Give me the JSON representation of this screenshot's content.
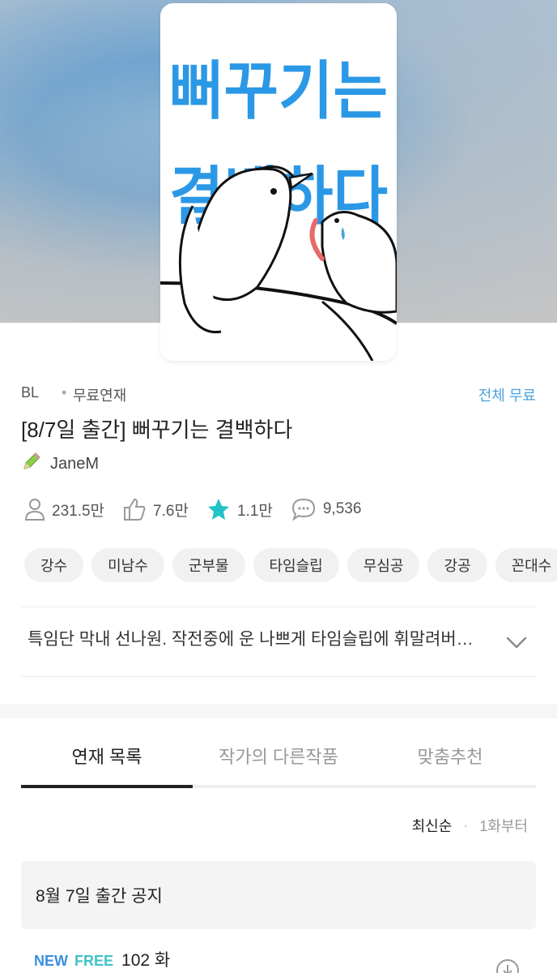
{
  "work": {
    "genre": "BL",
    "serial_type": "무료연재",
    "free_badge": "전체 무료",
    "title": "[8/7일 출간] 뻐꾸기는 결백하다",
    "author": "JaneM",
    "cover_title_line1": "뻐꾸기는",
    "cover_title_line2": "결백하다"
  },
  "stats": {
    "views": "231.5만",
    "likes": "7.6만",
    "favorites": "1.1만",
    "comments": "9,536"
  },
  "tags": [
    "강수",
    "미남수",
    "군부물",
    "타임슬립",
    "무심공",
    "강공",
    "꼰대수"
  ],
  "synopsis": "특임단 막내 선나원. 작전중에 운 나쁘게 타임슬립에 휘말려버…",
  "tabs": {
    "items": [
      "연재 목록",
      "작가의 다른작품",
      "맞춤추천"
    ],
    "active": 0
  },
  "sort": {
    "latest": "최신순",
    "separator": "·",
    "from_first": "1화부터"
  },
  "notice": "8월 7일 출간 공지",
  "episode": {
    "badge_new": "NEW",
    "badge_free": "FREE",
    "number": "102 화"
  },
  "colors": {
    "accent": "#4aa3dc",
    "new": "#3a8ee0",
    "free": "#3fc2c8",
    "star": "#1fc3c8"
  },
  "icons": {
    "author": "pencil-icon",
    "views": "person-icon",
    "likes": "thumbs-up-icon",
    "favorites": "star-icon",
    "comments": "chat-bubble-icon",
    "expand": "chevron-down-icon",
    "download": "download-icon"
  }
}
